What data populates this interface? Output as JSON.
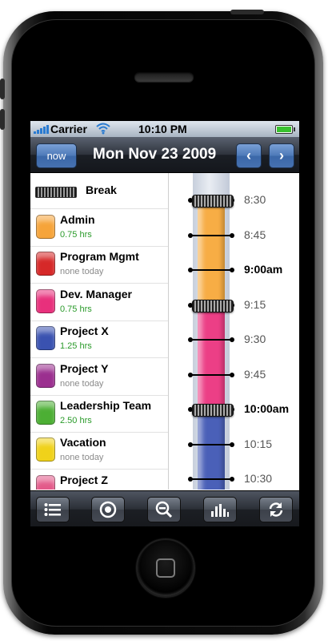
{
  "status_bar": {
    "carrier": "Carrier",
    "time": "10:10 PM",
    "icons": [
      "signal-icon",
      "wifi-icon",
      "battery-icon"
    ]
  },
  "nav": {
    "now_label": "now",
    "date_title": "Mon Nov 23 2009",
    "prev_label": "‹",
    "next_label": "›"
  },
  "categories": {
    "break_label": "Break",
    "items": [
      {
        "name": "Admin",
        "hours": "0.75 hrs",
        "color": "#f6a43a",
        "hours_color": "#2a9a2a"
      },
      {
        "name": "Program Mgmt",
        "hours": "none today",
        "color": "#d62828",
        "hours_color": "#8a8a8a"
      },
      {
        "name": "Dev. Manager",
        "hours": "0.75 hrs",
        "color": "#e8307c",
        "hours_color": "#2a9a2a"
      },
      {
        "name": "Project X",
        "hours": "1.25 hrs",
        "color": "#3a52b0",
        "hours_color": "#2a9a2a"
      },
      {
        "name": "Project Y",
        "hours": "none today",
        "color": "#9b2f8f",
        "hours_color": "#8a8a8a"
      },
      {
        "name": "Leadership Team",
        "hours": "2.50 hrs",
        "color": "#4caf34",
        "hours_color": "#2a9a2a"
      },
      {
        "name": "Vacation",
        "hours": "none today",
        "color": "#f0d21a",
        "hours_color": "#8a8a8a"
      },
      {
        "name": "Project Z",
        "hours": "",
        "color": "#e35a8a",
        "hours_color": "#8a8a8a"
      }
    ]
  },
  "timeline": {
    "ticks": [
      {
        "label": "8:30",
        "bold": false
      },
      {
        "label": "8:45",
        "bold": false
      },
      {
        "label": "9:00am",
        "bold": true
      },
      {
        "label": "9:15",
        "bold": false
      },
      {
        "label": "9:30",
        "bold": false
      },
      {
        "label": "9:45",
        "bold": false
      },
      {
        "label": "10:00am",
        "bold": true
      },
      {
        "label": "10:15",
        "bold": false
      },
      {
        "label": "10:30",
        "bold": false
      }
    ],
    "segments": [
      {
        "category": "Admin",
        "color": "#f7ad45"
      },
      {
        "category": "Dev. Manager",
        "color": "#ec3f86"
      },
      {
        "category": "Project X",
        "color": "#4a60b8"
      }
    ]
  },
  "toolbar": {
    "buttons": [
      "list-icon",
      "target-icon",
      "zoom-out-icon",
      "chart-icon",
      "refresh-icon"
    ]
  }
}
